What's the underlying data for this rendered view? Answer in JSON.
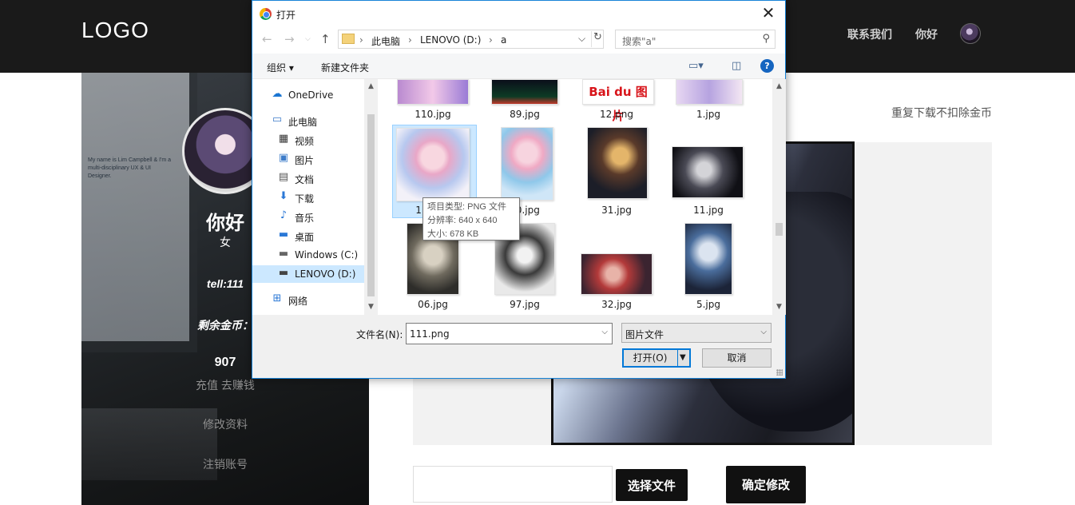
{
  "header": {
    "logo": "LOGO",
    "nav": [
      "联系我们",
      "你好"
    ]
  },
  "sidebar": {
    "monitor_text": "My name is Lim Campbell & I'm a multi-disciplinary UX & UI Designer.",
    "name": "你好",
    "gender": "女",
    "tell": "tell:111",
    "coins_label": "剩余金币：",
    "coins": "907",
    "recharge": "充值 去赚钱",
    "edit_profile": "修改资料",
    "logout": "注销账号"
  },
  "main": {
    "note": "重复下载不扣除金币",
    "choose_file": "选择文件",
    "confirm": "确定修改"
  },
  "dialog": {
    "title": "打开",
    "close": "✕",
    "breadcrumb": [
      "此电脑",
      "LENOVO (D:)",
      "a"
    ],
    "search_placeholder": "搜索\"a\"",
    "toolbar": {
      "organize": "组织 ▾",
      "new_folder": "新建文件夹",
      "help": "?"
    },
    "nav_pane": [
      {
        "label": "OneDrive",
        "icon": "cloud-icon"
      },
      {
        "label": "此电脑",
        "icon": "computer-icon"
      },
      {
        "label": "视频",
        "icon": "video-icon"
      },
      {
        "label": "图片",
        "icon": "pictures-icon"
      },
      {
        "label": "文档",
        "icon": "document-icon"
      },
      {
        "label": "下载",
        "icon": "download-icon"
      },
      {
        "label": "音乐",
        "icon": "music-icon"
      },
      {
        "label": "桌面",
        "icon": "desktop-icon"
      },
      {
        "label": "Windows (C:)",
        "icon": "drive-icon"
      },
      {
        "label": "LENOVO (D:)",
        "icon": "drive-icon",
        "selected": true
      },
      {
        "label": "网络",
        "icon": "network-icon"
      }
    ],
    "files": [
      {
        "name": "110.jpg"
      },
      {
        "name": "89.jpg"
      },
      {
        "name": "12.png"
      },
      {
        "name": "1.jpg"
      },
      {
        "name": "111.png",
        "selected": true
      },
      {
        "name": "10.jpg"
      },
      {
        "name": "31.jpg"
      },
      {
        "name": "11.jpg"
      },
      {
        "name": "06.jpg"
      },
      {
        "name": "97.jpg"
      },
      {
        "name": "32.jpg"
      },
      {
        "name": "5.jpg"
      }
    ],
    "baidu_logo": "Bai du 图片",
    "tooltip": [
      "项目类型: PNG 文件",
      "分辨率: 640 x 640",
      "大小: 678 KB"
    ],
    "filename_label": "文件名(N):",
    "filename_value": "111.png",
    "filetype_value": "图片文件",
    "open_button": "打开(O)",
    "cancel_button": "取消"
  }
}
